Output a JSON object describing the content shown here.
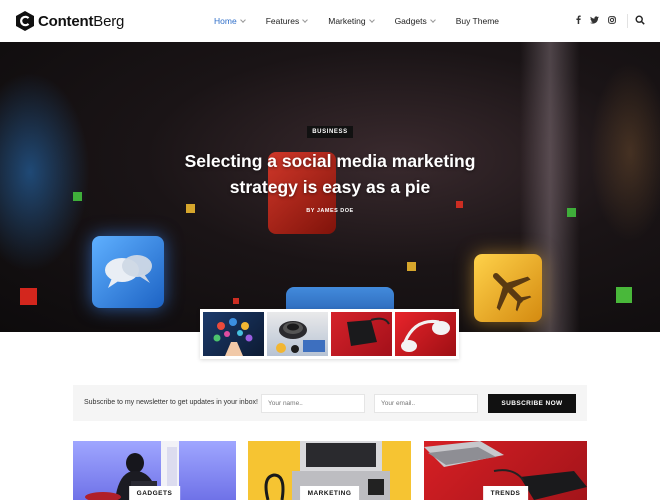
{
  "brand": {
    "name_bold": "Content",
    "name_light": "Berg"
  },
  "nav": {
    "items": [
      {
        "label": "Home",
        "has_dropdown": true,
        "active": true
      },
      {
        "label": "Features",
        "has_dropdown": true,
        "active": false
      },
      {
        "label": "Marketing",
        "has_dropdown": true,
        "active": false
      },
      {
        "label": "Gadgets",
        "has_dropdown": true,
        "active": false
      },
      {
        "label": "Buy Theme",
        "has_dropdown": false,
        "active": false
      }
    ],
    "social_icons": [
      "facebook-icon",
      "twitter-icon",
      "instagram-icon"
    ],
    "search_icon": "search-icon",
    "active_color": "#2e6ec9"
  },
  "hero": {
    "category": "BUSINESS",
    "title": "Selecting a social media marketing strategy is easy as a pie",
    "author": "BY JAMES DOE"
  },
  "newsletter": {
    "text": "Subscribe to my newsletter to get updates in your inbox!",
    "name_placeholder": "Your name..",
    "email_placeholder": "Your email..",
    "button_label": "SUBSCRIBE NOW"
  },
  "cards": [
    {
      "label": "GADGETS"
    },
    {
      "label": "MARKETING"
    },
    {
      "label": "TRENDS"
    }
  ]
}
